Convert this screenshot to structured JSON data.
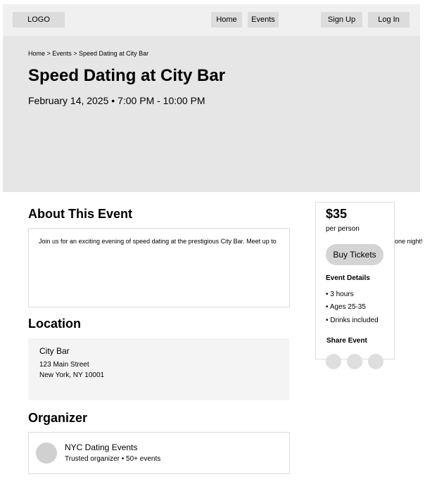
{
  "header": {
    "logo": "LOGO",
    "nav": {
      "home": "Home",
      "events": "Events"
    },
    "auth": {
      "signup": "Sign Up",
      "login": "Log In"
    }
  },
  "hero": {
    "breadcrumb": "Home > Events > Speed Dating at City Bar",
    "title": "Speed Dating at City Bar",
    "datetime": "February 14, 2025 • 7:00 PM - 10:00 PM"
  },
  "about": {
    "heading": "About This Event",
    "text": "Join us for an exciting evening of speed dating at the prestigious City Bar. Meet up to"
  },
  "location": {
    "heading": "Location",
    "name": "City Bar",
    "street": "123 Main Street",
    "city": "New York, NY 10001"
  },
  "organizer": {
    "heading": "Organizer",
    "name": "NYC Dating Events",
    "subtitle": "Trusted organizer • 50+ events"
  },
  "ticket": {
    "price": "$35",
    "per": "per person",
    "buy_label": "Buy Tickets",
    "details_heading": "Event Details",
    "details": [
      "• 3 hours",
      "• Ages 25-35",
      "• Drinks included"
    ],
    "overflow_text": "one night!",
    "share_heading": "Share Event",
    "share_icons": [
      "share-option-1",
      "share-option-2",
      "share-option-3"
    ]
  }
}
